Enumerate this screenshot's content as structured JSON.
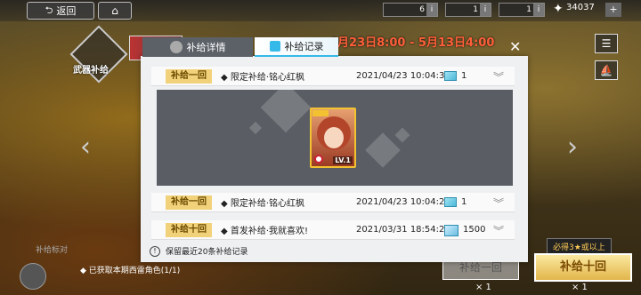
{
  "topbar": {
    "back_label": "返回",
    "resource_1": "6",
    "resource_2": "1",
    "resource_3": "1",
    "coins": "34037",
    "plus": "+"
  },
  "background": {
    "weapon_label": "武器补给",
    "date_range": "4月23日8:00 - 5月13日4:00",
    "bottom_title": "补给标对",
    "bottom_note": "◆ 已获取本期西雷角色(1/1)",
    "bonus_tag": "必得3★或以上",
    "pull_ten_label": "补给十回",
    "pull_one_label": "补给一回",
    "count_1": "× 1",
    "count_2": "× 1"
  },
  "modal": {
    "tab_detail": "补给详情",
    "tab_record": "补给记录",
    "close": "✕",
    "rows": [
      {
        "badge": "补给一回",
        "name": "◆ 限定补给·铭心红枫",
        "time": "2021/04/23 10:04:32",
        "qty": "1"
      },
      {
        "badge": "补给一回",
        "name": "◆ 限定补给·铭心红枫",
        "time": "2021/04/23 10:04:23",
        "qty": "1"
      },
      {
        "badge": "补给十回",
        "name": "◆ 首发补给·我就喜欢!",
        "time": "2021/03/31 18:54:27",
        "qty": "1500"
      }
    ],
    "card_level": "LV.1",
    "notice": "保留最近20条补给记录"
  }
}
